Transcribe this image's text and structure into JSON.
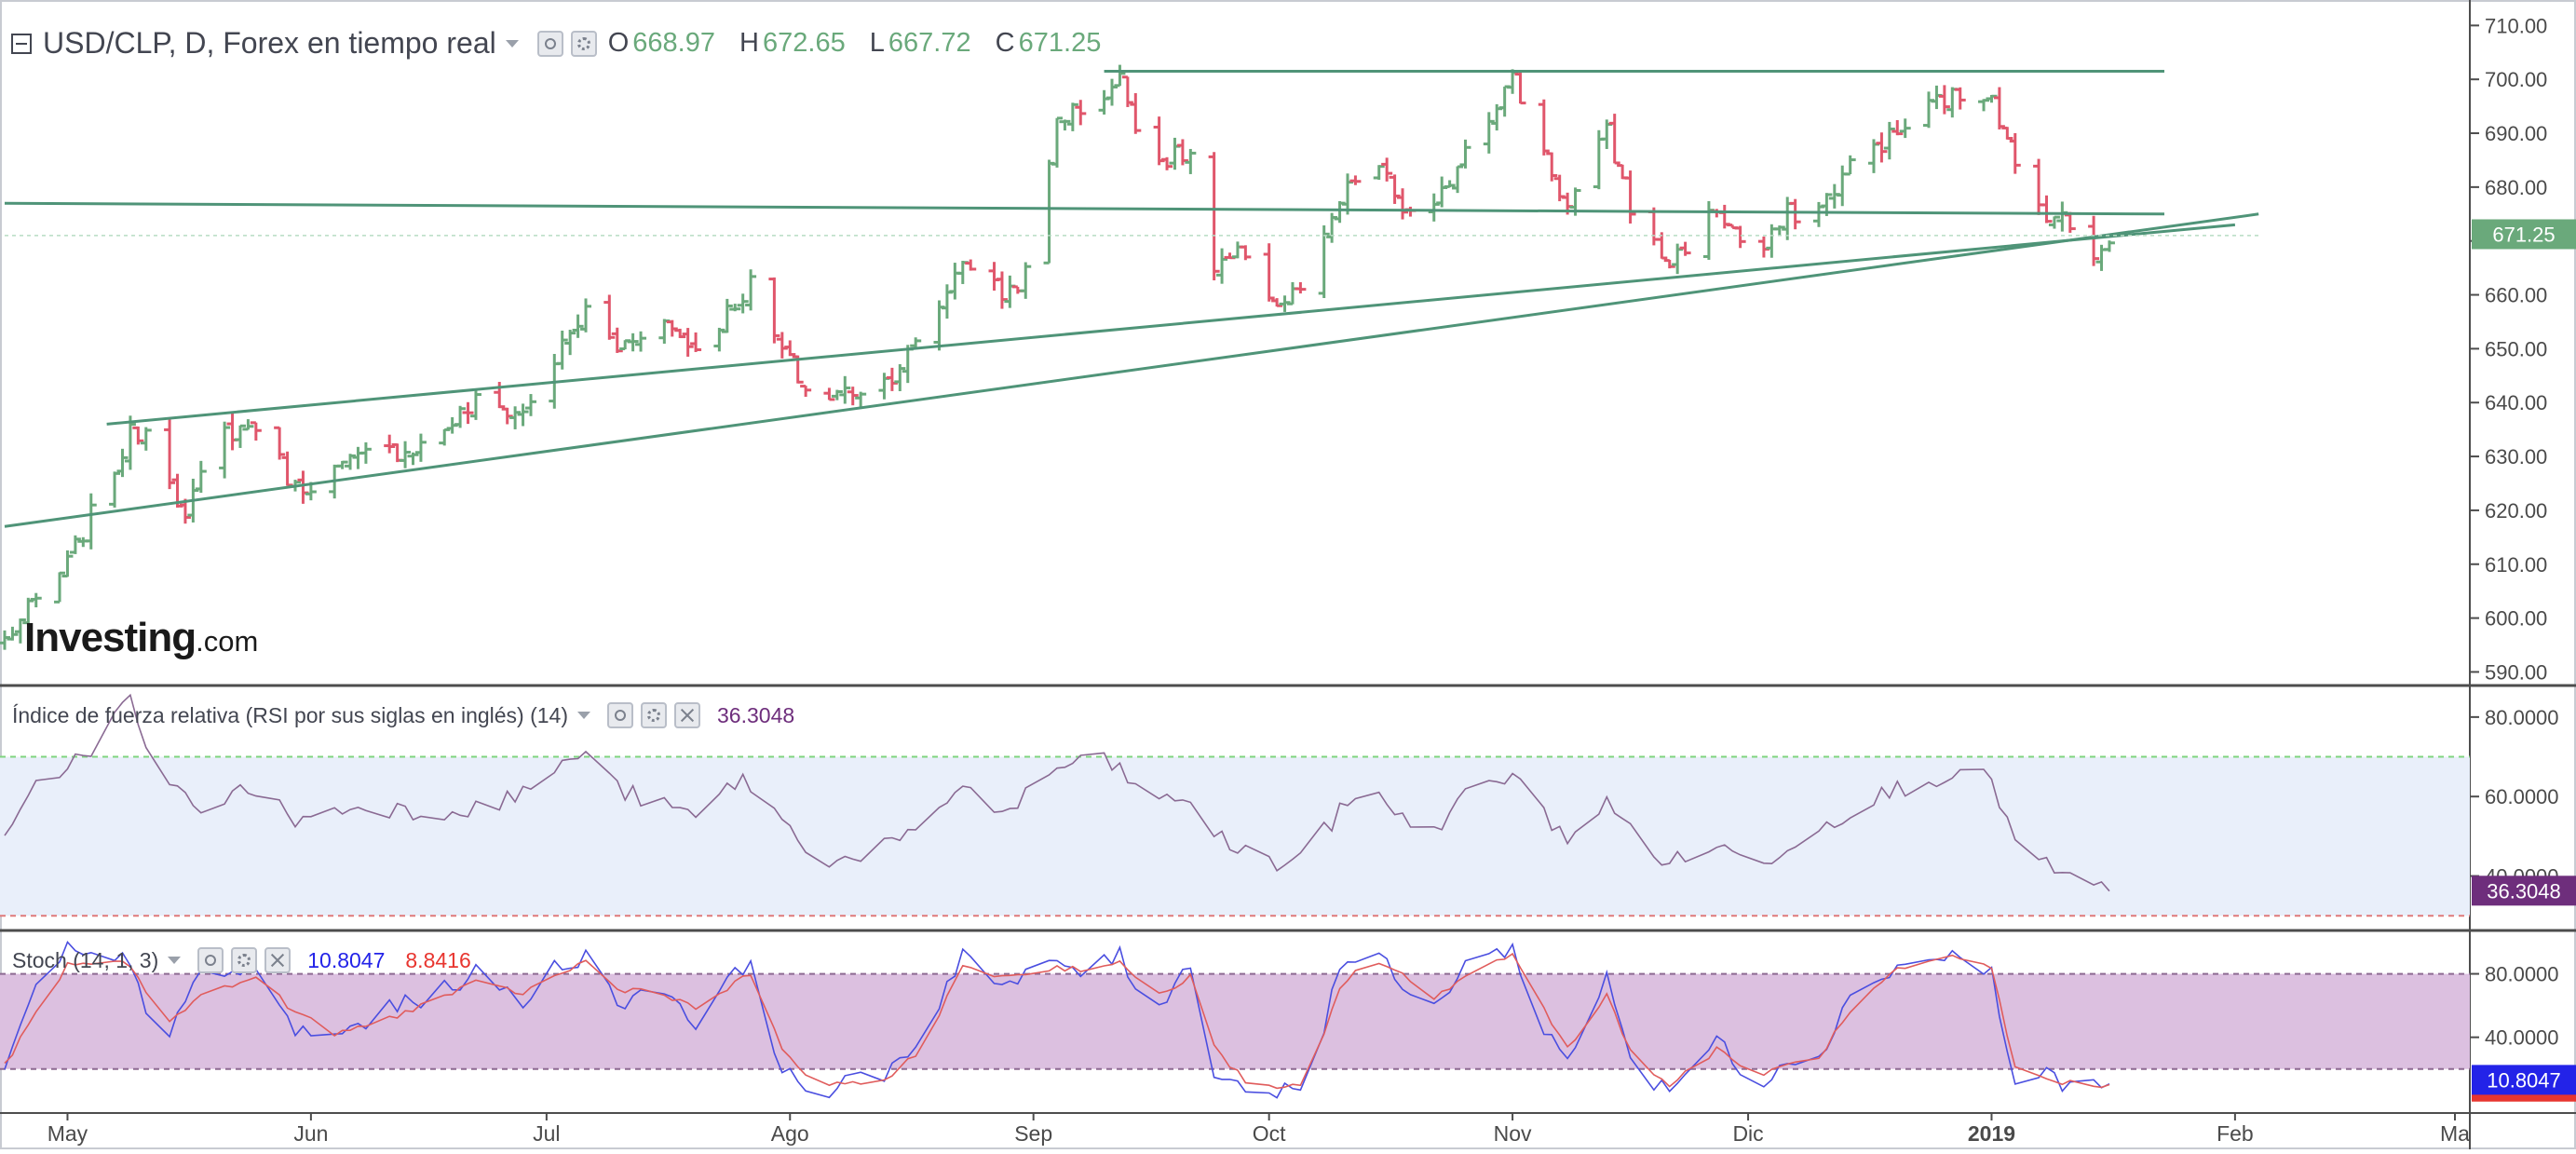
{
  "header": {
    "title": "USD/CLP, D, Forex en tiempo real",
    "open_label": "O",
    "open_value": "668.97",
    "high_label": "H",
    "high_value": "672.65",
    "low_label": "L",
    "low_value": "667.72",
    "close_label": "C",
    "close_value": "671.25"
  },
  "rsi_header": {
    "title": "Índice de fuerza relativa (RSI por sus siglas en inglés) (14)",
    "value": "36.3048"
  },
  "stoch_header": {
    "title": "Stoch (14, 1, 3)",
    "k_value": "10.8047",
    "d_value": "8.8416"
  },
  "logo": {
    "main": "Investing",
    "suffix": ".com"
  },
  "colors": {
    "up": "#6aa97b",
    "down": "#e0566b",
    "trendline": "#4f9478",
    "rsi_line": "#8a6a93",
    "rsi_band": "#e9effa",
    "stoch_band": "#dcc0e0",
    "k_line": "#4a4ee0",
    "d_line": "#e05c5c",
    "rsi_badge": "#6e2e7c",
    "k_badge": "#2323e8",
    "d_badge": "#e8352f",
    "price_badge": "#6aa97b"
  },
  "chart_data": [
    {
      "type": "candlestick",
      "title": "USD/CLP, D, Forex en tiempo real",
      "x_ticks": [
        "May",
        "Jun",
        "Jul",
        "Ago",
        "Sep",
        "Oct",
        "Nov",
        "Dic",
        "2019",
        "Feb",
        "Ma"
      ],
      "y_ticks": [
        "590.00",
        "600.00",
        "610.00",
        "620.00",
        "630.00",
        "640.00",
        "650.00",
        "660.00",
        "670.00",
        "680.00",
        "690.00",
        "700.00",
        "710.00"
      ],
      "ylim": [
        588,
        713
      ],
      "last_price": "671.25",
      "anchors": [
        [
          "2018-04-23",
          596
        ],
        [
          "2018-05-01",
          610
        ],
        [
          "2018-05-05",
          622
        ],
        [
          "2018-05-09",
          634
        ],
        [
          "2018-05-12",
          636
        ],
        [
          "2018-05-16",
          618
        ],
        [
          "2018-05-20",
          634
        ],
        [
          "2018-05-25",
          636
        ],
        [
          "2018-05-30",
          624
        ],
        [
          "2018-06-08",
          630
        ],
        [
          "2018-06-15",
          632
        ],
        [
          "2018-06-22",
          640
        ],
        [
          "2018-06-28",
          638
        ],
        [
          "2018-07-02",
          648
        ],
        [
          "2018-07-06",
          657
        ],
        [
          "2018-07-10",
          650
        ],
        [
          "2018-07-15",
          656
        ],
        [
          "2018-07-20",
          650
        ],
        [
          "2018-07-27",
          662
        ],
        [
          "2018-07-30",
          652
        ],
        [
          "2018-08-04",
          640
        ],
        [
          "2018-08-08",
          642
        ],
        [
          "2018-08-13",
          644
        ],
        [
          "2018-08-18",
          652
        ],
        [
          "2018-08-23",
          667
        ],
        [
          "2018-08-28",
          660
        ],
        [
          "2018-09-01",
          665
        ],
        [
          "2018-09-04",
          693
        ],
        [
          "2018-09-08",
          695
        ],
        [
          "2018-09-12",
          700
        ],
        [
          "2018-09-16",
          685
        ],
        [
          "2018-09-21",
          686
        ],
        [
          "2018-09-24",
          664
        ],
        [
          "2018-09-28",
          668
        ],
        [
          "2018-10-02",
          658
        ],
        [
          "2018-10-06",
          662
        ],
        [
          "2018-10-10",
          677
        ],
        [
          "2018-10-14",
          686
        ],
        [
          "2018-10-18",
          676
        ],
        [
          "2018-10-21",
          672
        ],
        [
          "2018-10-26",
          688
        ],
        [
          "2018-11-01",
          700
        ],
        [
          "2018-11-04",
          690
        ],
        [
          "2018-11-08",
          676
        ],
        [
          "2018-11-13",
          690
        ],
        [
          "2018-11-17",
          672
        ],
        [
          "2018-11-21",
          666
        ],
        [
          "2018-11-27",
          676
        ],
        [
          "2018-12-02",
          666
        ],
        [
          "2018-12-06",
          675
        ],
        [
          "2018-12-10",
          676
        ],
        [
          "2018-12-15",
          686
        ],
        [
          "2018-12-20",
          690
        ],
        [
          "2018-12-25",
          696
        ],
        [
          "2019-01-01",
          698
        ],
        [
          "2019-01-05",
          678
        ],
        [
          "2019-01-10",
          674
        ],
        [
          "2019-01-14",
          668
        ],
        [
          "2019-01-16",
          671
        ]
      ],
      "trendlines": [
        {
          "from": [
            "2018-09-10",
            701.5
          ],
          "to": [
            "2019-01-23",
            701.5
          ]
        },
        {
          "from": [
            "2018-04-23",
            677
          ],
          "to": [
            "2019-01-23",
            675
          ]
        },
        {
          "from": [
            "2018-05-06",
            636
          ],
          "to": [
            "2019-02-01",
            673
          ]
        },
        {
          "from": [
            "2018-04-23",
            617
          ],
          "to": [
            "2019-02-04",
            675
          ]
        },
        {
          "from": [
            "2018-04-23",
            671
          ],
          "to": [
            "2019-02-04",
            671
          ]
        }
      ]
    },
    {
      "type": "line",
      "title": "Índice de fuerza relativa (RSI por sus siglas en inglés) (14)",
      "y_ticks": [
        "40.0000",
        "60.0000",
        "80.0000"
      ],
      "ylim": [
        27,
        87
      ],
      "bands": [
        30,
        70
      ],
      "last_value": "36.3048",
      "anchors": [
        [
          "2018-04-23",
          48
        ],
        [
          "2018-04-27",
          62
        ],
        [
          "2018-05-01",
          68
        ],
        [
          "2018-05-05",
          74
        ],
        [
          "2018-05-09",
          85
        ],
        [
          "2018-05-12",
          64
        ],
        [
          "2018-05-18",
          58
        ],
        [
          "2018-05-25",
          62
        ],
        [
          "2018-05-30",
          54
        ],
        [
          "2018-06-08",
          58
        ],
        [
          "2018-06-15",
          56
        ],
        [
          "2018-06-25",
          58
        ],
        [
          "2018-07-02",
          66
        ],
        [
          "2018-07-06",
          72
        ],
        [
          "2018-07-10",
          62
        ],
        [
          "2018-07-15",
          58
        ],
        [
          "2018-07-20",
          55
        ],
        [
          "2018-07-26",
          65
        ],
        [
          "2018-07-30",
          56
        ],
        [
          "2018-08-04",
          45
        ],
        [
          "2018-08-08",
          44
        ],
        [
          "2018-08-13",
          48
        ],
        [
          "2018-08-18",
          50
        ],
        [
          "2018-08-23",
          64
        ],
        [
          "2018-08-28",
          55
        ],
        [
          "2018-09-04",
          67
        ],
        [
          "2018-09-08",
          70
        ],
        [
          "2018-09-12",
          67
        ],
        [
          "2018-09-16",
          58
        ],
        [
          "2018-09-21",
          60
        ],
        [
          "2018-09-24",
          50
        ],
        [
          "2018-09-28",
          46
        ],
        [
          "2018-10-02",
          43
        ],
        [
          "2018-10-06",
          46
        ],
        [
          "2018-10-10",
          56
        ],
        [
          "2018-10-14",
          64
        ],
        [
          "2018-10-18",
          54
        ],
        [
          "2018-10-21",
          50
        ],
        [
          "2018-10-26",
          60
        ],
        [
          "2018-11-01",
          66
        ],
        [
          "2018-11-04",
          57
        ],
        [
          "2018-11-08",
          50
        ],
        [
          "2018-11-13",
          58
        ],
        [
          "2018-11-17",
          50
        ],
        [
          "2018-11-21",
          43
        ],
        [
          "2018-11-27",
          48
        ],
        [
          "2018-12-02",
          42
        ],
        [
          "2018-12-06",
          48
        ],
        [
          "2018-12-10",
          52
        ],
        [
          "2018-12-15",
          58
        ],
        [
          "2018-12-20",
          62
        ],
        [
          "2018-12-27",
          66
        ],
        [
          "2019-01-01",
          64
        ],
        [
          "2019-01-05",
          44
        ],
        [
          "2019-01-10",
          41
        ],
        [
          "2019-01-14",
          36
        ],
        [
          "2019-01-16",
          38
        ]
      ]
    },
    {
      "type": "line",
      "title": "Stoch (14, 1, 3)",
      "y_ticks": [
        "40.0000",
        "80.0000"
      ],
      "ylim": [
        -6,
        105
      ],
      "bands": [
        20,
        80
      ],
      "last_k": "10.8047",
      "last_d": "8.8416",
      "series": [
        {
          "name": "10.8047",
          "anchors": [
            [
              "2018-04-23",
              18
            ],
            [
              "2018-04-27",
              70
            ],
            [
              "2018-05-01",
              95
            ],
            [
              "2018-05-05",
              86
            ],
            [
              "2018-05-09",
              90
            ],
            [
              "2018-05-13",
              30
            ],
            [
              "2018-05-18",
              80
            ],
            [
              "2018-05-25",
              82
            ],
            [
              "2018-05-30",
              44
            ],
            [
              "2018-06-04",
              40
            ],
            [
              "2018-06-10",
              56
            ],
            [
              "2018-06-15",
              64
            ],
            [
              "2018-06-22",
              80
            ],
            [
              "2018-06-28",
              62
            ],
            [
              "2018-07-02",
              84
            ],
            [
              "2018-07-06",
              92
            ],
            [
              "2018-07-10",
              60
            ],
            [
              "2018-07-15",
              76
            ],
            [
              "2018-07-20",
              50
            ],
            [
              "2018-07-27",
              90
            ],
            [
              "2018-07-31",
              18
            ],
            [
              "2018-08-04",
              5
            ],
            [
              "2018-08-08",
              10
            ],
            [
              "2018-08-13",
              18
            ],
            [
              "2018-08-18",
              40
            ],
            [
              "2018-08-23",
              95
            ],
            [
              "2018-08-28",
              70
            ],
            [
              "2018-09-04",
              88
            ],
            [
              "2018-09-08",
              80
            ],
            [
              "2018-09-12",
              92
            ],
            [
              "2018-09-16",
              55
            ],
            [
              "2018-09-21",
              86
            ],
            [
              "2018-09-24",
              20
            ],
            [
              "2018-09-28",
              8
            ],
            [
              "2018-10-02",
              5
            ],
            [
              "2018-10-06",
              12
            ],
            [
              "2018-10-10",
              85
            ],
            [
              "2018-10-14",
              95
            ],
            [
              "2018-10-18",
              72
            ],
            [
              "2018-10-21",
              50
            ],
            [
              "2018-10-26",
              88
            ],
            [
              "2018-11-01",
              95
            ],
            [
              "2018-11-04",
              55
            ],
            [
              "2018-11-08",
              24
            ],
            [
              "2018-11-13",
              80
            ],
            [
              "2018-11-17",
              12
            ],
            [
              "2018-11-21",
              6
            ],
            [
              "2018-11-27",
              38
            ],
            [
              "2018-12-02",
              10
            ],
            [
              "2018-12-06",
              26
            ],
            [
              "2018-12-10",
              30
            ],
            [
              "2018-12-15",
              72
            ],
            [
              "2018-12-20",
              85
            ],
            [
              "2018-12-27",
              92
            ],
            [
              "2019-01-01",
              80
            ],
            [
              "2019-01-04",
              8
            ],
            [
              "2019-01-08",
              18
            ],
            [
              "2019-01-12",
              6
            ],
            [
              "2019-01-16",
              12
            ]
          ]
        },
        {
          "name": "8.8416",
          "anchors": [
            [
              "2018-04-23",
              22
            ],
            [
              "2018-04-27",
              55
            ],
            [
              "2018-05-01",
              85
            ],
            [
              "2018-05-05",
              88
            ],
            [
              "2018-05-09",
              86
            ],
            [
              "2018-05-13",
              48
            ],
            [
              "2018-05-18",
              66
            ],
            [
              "2018-05-25",
              78
            ],
            [
              "2018-05-30",
              56
            ],
            [
              "2018-06-04",
              42
            ],
            [
              "2018-06-10",
              50
            ],
            [
              "2018-06-15",
              60
            ],
            [
              "2018-06-22",
              74
            ],
            [
              "2018-06-28",
              68
            ],
            [
              "2018-07-02",
              78
            ],
            [
              "2018-07-06",
              88
            ],
            [
              "2018-07-10",
              70
            ],
            [
              "2018-07-15",
              70
            ],
            [
              "2018-07-20",
              58
            ],
            [
              "2018-07-27",
              80
            ],
            [
              "2018-07-31",
              32
            ],
            [
              "2018-08-04",
              12
            ],
            [
              "2018-08-08",
              9
            ],
            [
              "2018-08-13",
              14
            ],
            [
              "2018-08-18",
              32
            ],
            [
              "2018-08-23",
              86
            ],
            [
              "2018-08-28",
              78
            ],
            [
              "2018-09-04",
              84
            ],
            [
              "2018-09-08",
              83
            ],
            [
              "2018-09-12",
              88
            ],
            [
              "2018-09-16",
              64
            ],
            [
              "2018-09-21",
              78
            ],
            [
              "2018-09-24",
              34
            ],
            [
              "2018-09-28",
              12
            ],
            [
              "2018-10-02",
              7
            ],
            [
              "2018-10-06",
              10
            ],
            [
              "2018-10-10",
              72
            ],
            [
              "2018-10-14",
              90
            ],
            [
              "2018-10-18",
              80
            ],
            [
              "2018-10-21",
              60
            ],
            [
              "2018-10-26",
              80
            ],
            [
              "2018-11-01",
              92
            ],
            [
              "2018-11-04",
              66
            ],
            [
              "2018-11-08",
              34
            ],
            [
              "2018-11-13",
              66
            ],
            [
              "2018-11-17",
              22
            ],
            [
              "2018-11-21",
              10
            ],
            [
              "2018-11-27",
              32
            ],
            [
              "2018-12-02",
              16
            ],
            [
              "2018-12-06",
              22
            ],
            [
              "2018-12-10",
              28
            ],
            [
              "2018-12-15",
              62
            ],
            [
              "2018-12-20",
              82
            ],
            [
              "2018-12-27",
              90
            ],
            [
              "2019-01-01",
              84
            ],
            [
              "2019-01-04",
              20
            ],
            [
              "2019-01-08",
              14
            ],
            [
              "2019-01-12",
              10
            ],
            [
              "2019-01-16",
              9
            ]
          ]
        }
      ]
    }
  ]
}
